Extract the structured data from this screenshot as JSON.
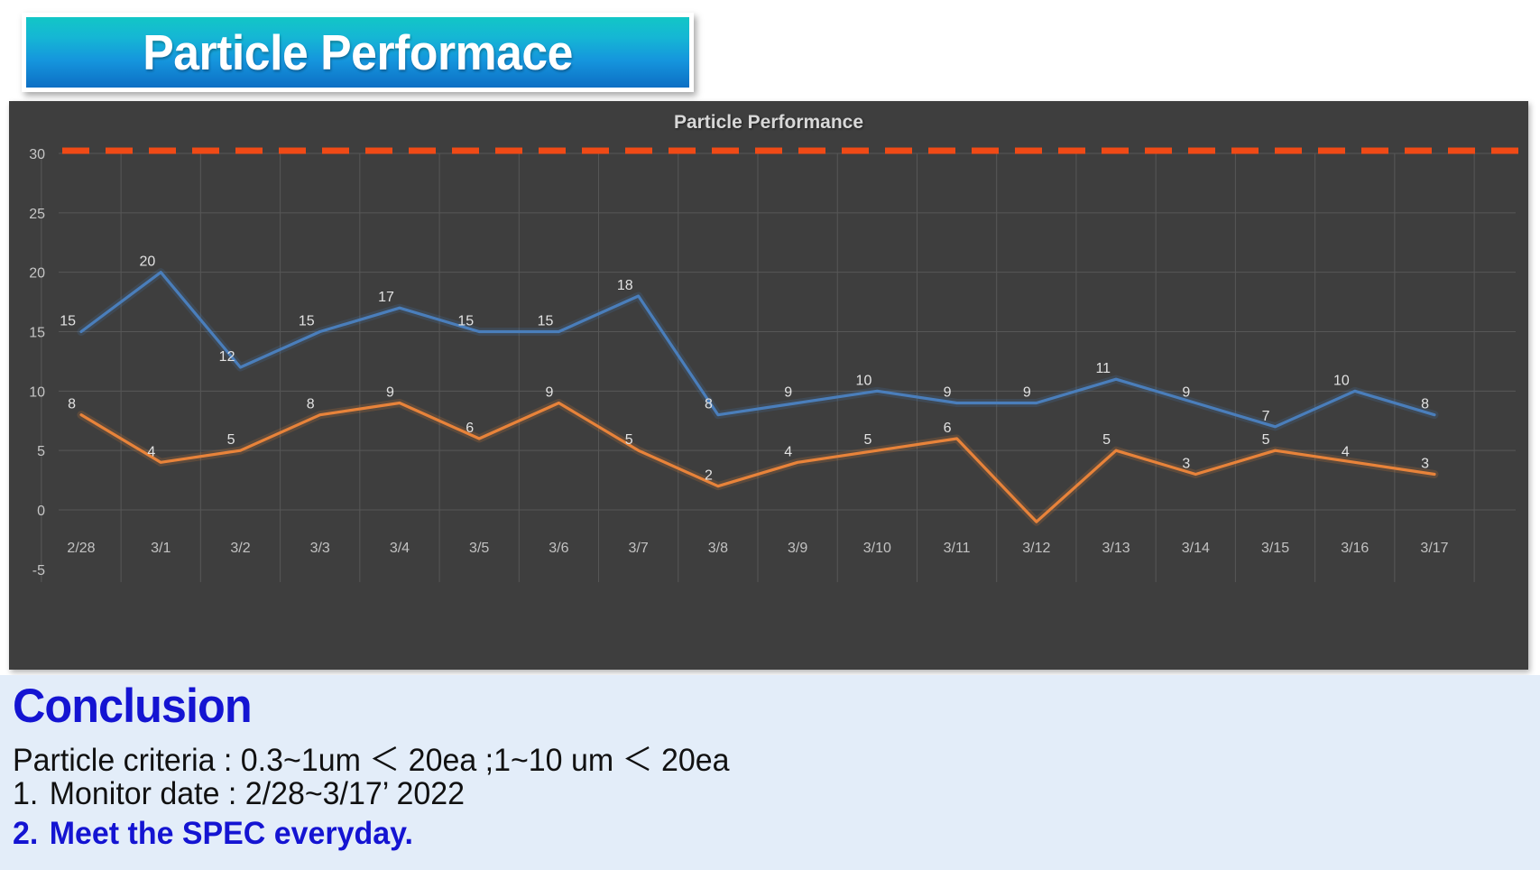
{
  "banner": {
    "title": "Particle Performace"
  },
  "chart_data": {
    "type": "line",
    "title": "Particle Performance",
    "xlabel": "",
    "ylabel": "",
    "ylim": [
      -5,
      30
    ],
    "yticks": [
      -5,
      0,
      5,
      10,
      15,
      20,
      25,
      30
    ],
    "grid": true,
    "legend": "none",
    "categories": [
      "2/28",
      "3/1",
      "3/2",
      "3/3",
      "3/4",
      "3/5",
      "3/6",
      "3/7",
      "3/8",
      "3/9",
      "3/10",
      "3/11",
      "3/12",
      "3/13",
      "3/14",
      "3/15",
      "3/16",
      "3/17"
    ],
    "series": [
      {
        "name": "0.3~1um",
        "color": "#4a7ebb",
        "values": [
          15,
          20,
          12,
          15,
          17,
          15,
          15,
          18,
          8,
          9,
          10,
          9,
          9,
          11,
          9,
          7,
          10,
          8
        ],
        "labels": [
          "15",
          "20",
          "12",
          "15",
          "17",
          "15",
          "15",
          "18",
          "8",
          "9",
          "10",
          "9",
          "9",
          "11",
          "9",
          "7",
          "10",
          "8"
        ]
      },
      {
        "name": "1~10um",
        "color": "#e8833a",
        "values": [
          8,
          4,
          5,
          8,
          9,
          6,
          9,
          5,
          2,
          4,
          5,
          6,
          -1,
          5,
          3,
          5,
          4,
          3
        ],
        "labels": [
          "8",
          "4",
          "5",
          "8",
          "9",
          "6",
          "9",
          "5",
          "2",
          "4",
          "5",
          "6",
          "",
          "5",
          "3",
          "5",
          "4",
          "3"
        ]
      }
    ],
    "annotations": [
      {
        "name": "spec-limit-line",
        "type": "hline",
        "value": 30,
        "color": "#f04a16",
        "style": "dashed"
      }
    ]
  },
  "conclusion": {
    "heading": "Conclusion",
    "criteria": "Particle criteria : 0.3~1um ＜ 20ea ;1~10 um ＜ 20ea",
    "item1_num": "1.",
    "item1_text": "Monitor date :   2/28~3/17’  2022",
    "item2_num": "2.",
    "item2_text": "Meet the SPEC everyday."
  }
}
